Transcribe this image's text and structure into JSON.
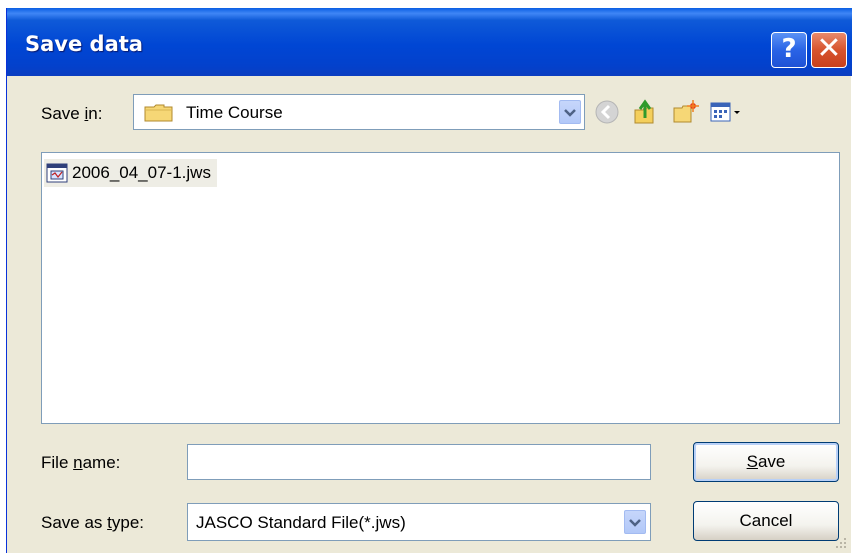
{
  "window": {
    "title": "Save data",
    "help_button": "?",
    "close_button": "✕"
  },
  "save_in": {
    "label_prefix": "Save ",
    "label_accel": "i",
    "label_suffix": "n:",
    "value": "Time Course"
  },
  "files": [
    {
      "name": "2006_04_07-1.jws"
    }
  ],
  "file_name": {
    "label_prefix": "File ",
    "label_accel": "n",
    "label_suffix": "ame:",
    "value": "",
    "placeholder": ""
  },
  "save_as_type": {
    "label_prefix": "Save as ",
    "label_accel": "t",
    "label_suffix": "ype:",
    "value": "JASCO Standard File(*.jws)"
  },
  "buttons": {
    "save_accel": "S",
    "save_rest": "ave",
    "cancel": "Cancel"
  },
  "icons": {
    "back": "back-arrow-icon",
    "up": "up-folder-icon",
    "new_folder": "new-folder-icon",
    "views": "views-menu-icon"
  },
  "colors": {
    "titlebar": "#0046d4",
    "dialog_bg": "#ece9d8",
    "close_red": "#d7542e"
  }
}
